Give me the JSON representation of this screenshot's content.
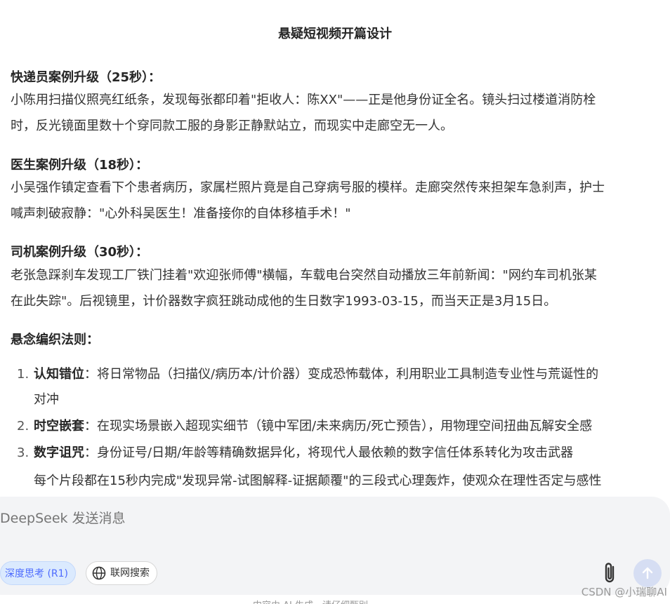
{
  "title": "悬疑短视频开篇设计",
  "sections": [
    {
      "heading": "快递员案例升级（25秒）：",
      "lines": [
        "小陈用扫描仪照亮红纸条，发现每张都印着\"拒收人：陈XX\"——正是他身份证全名。镜头扫过楼道消防栓",
        "时，反光镜面里数十个穿同款工服的身影正静默站立，而现实中走廊空无一人。"
      ]
    },
    {
      "heading": "医生案例升级（18秒）：",
      "lines": [
        "小吴强作镇定查看下个患者病历，家属栏照片竟是自己穿病号服的模样。走廊突然传来担架车急刹声，护士",
        "喊声刺破寂静：\"心外科吴医生！准备接你的自体移植手术！\""
      ]
    },
    {
      "heading": "司机案例升级（30秒）：",
      "lines": [
        "老张急踩刹车发现工厂铁门挂着\"欢迎张师傅\"横幅，车载电台突然自动播放三年前新闻：\"网约车司机张某",
        "在此失踪\"。后视镜里，计价器数字疯狂跳动成他的生日数字1993-03-15，而当天正是3月15日。"
      ]
    }
  ],
  "rules": {
    "heading": "悬念编织法则：",
    "items": [
      {
        "num": "1.",
        "term": "认知错位",
        "text": "：将日常物品（扫描仪/病历本/计价器）变成恐怖载体，利用职业工具制造专业性与荒诞性的",
        "text2": "对冲"
      },
      {
        "num": "2.",
        "term": "时空嵌套",
        "text": "：在现实场景嵌入超现实细节（镜中军团/未来病历/死亡预告），用物理空间扭曲瓦解安全感"
      },
      {
        "num": "3.",
        "term": "数字诅咒",
        "text": "：身份证号/日期/年龄等精确数据异化，将现代人最依赖的数字信任体系转化为攻击武器"
      }
    ],
    "trailing": "每个片段都在15秒内完成\"发现异常-试图解释-证据颠覆\"的三段式心理轰炸，使观众在理性否定与感性"
  },
  "composer": {
    "placeholder": "DeepSeek 发送消息",
    "deepthink_label": "深度思考 (R1)",
    "search_label": "联网搜索"
  },
  "footer_note": "内容由 AI 生成，请仔细甄别",
  "watermark": "CSDN @小瑞聊AI",
  "colors": {
    "accent": "#4d6bfe",
    "composer_bg": "#f3f4f6",
    "send_bg": "#d6def3"
  }
}
